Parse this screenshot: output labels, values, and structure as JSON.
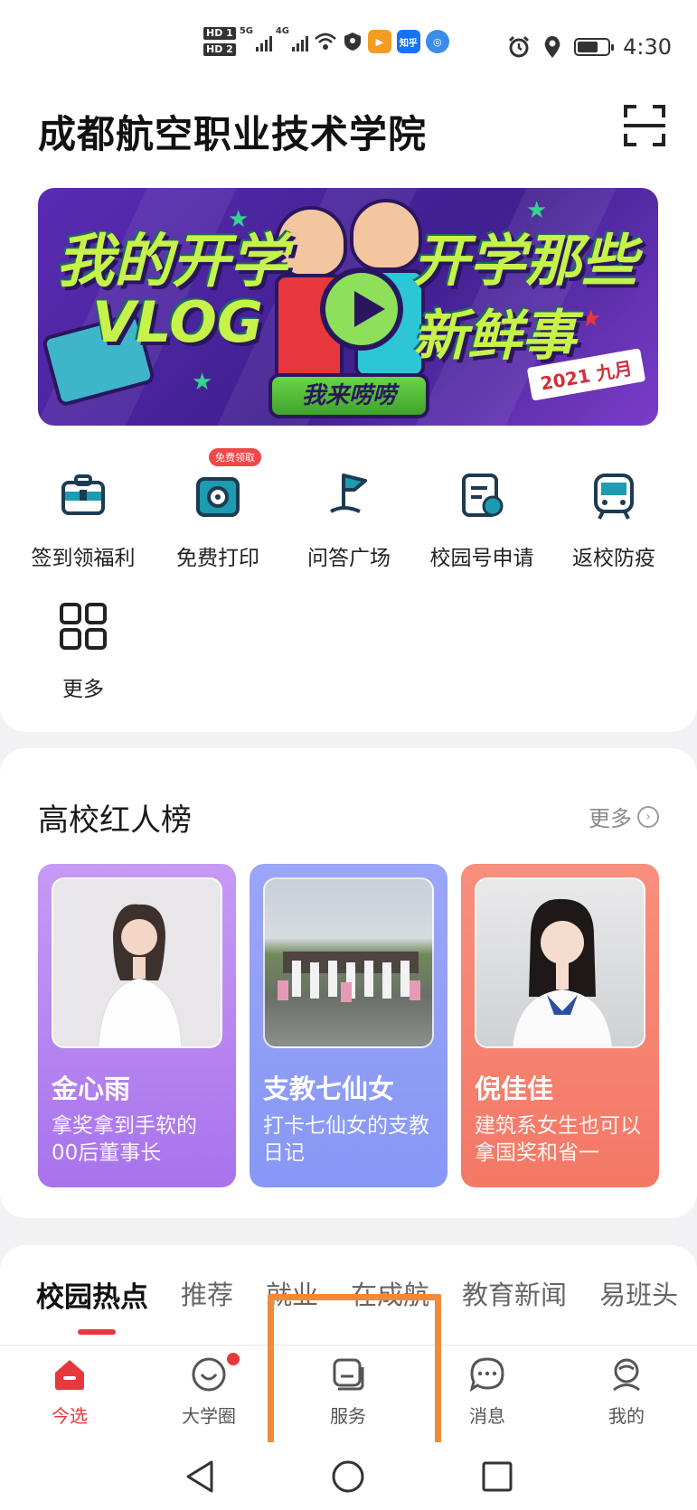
{
  "status_bar": {
    "hd1": "HD 1",
    "hd2": "HD 2",
    "net1": "5G",
    "net2": "4G",
    "app_zhihu": "知乎",
    "time": "4:30"
  },
  "header": {
    "title": "成都航空职业技术学院",
    "scan_icon": "scan-icon"
  },
  "banner": {
    "line1": "我的开学",
    "line2": "VLOG",
    "line3": "开学那些",
    "line4": "新鲜事",
    "button": "我来唠唠",
    "date": "2021 九月"
  },
  "quick_actions": [
    {
      "label": "签到领福利",
      "icon": "briefcase-icon"
    },
    {
      "label": "免费打印",
      "icon": "printer-icon",
      "badge": "免费领取"
    },
    {
      "label": "问答广场",
      "icon": "flag-icon"
    },
    {
      "label": "校园号申请",
      "icon": "application-icon"
    },
    {
      "label": "返校防疫",
      "icon": "train-icon"
    },
    {
      "label": "更多",
      "icon": "grid-icon"
    }
  ],
  "influencers": {
    "title": "高校红人榜",
    "more": "更多",
    "cards": [
      {
        "name": "金心雨",
        "desc": "拿奖拿到手软的00后董事长",
        "color": "#b27ef0"
      },
      {
        "name": "支教七仙女",
        "desc": "打卡七仙女的支教日记",
        "color": "#8d9ef7"
      },
      {
        "name": "倪佳佳",
        "desc": "建筑系女生也可以拿国奖和省一",
        "color": "#f6806d"
      }
    ]
  },
  "news_tabs": [
    "校园热点",
    "推荐",
    "就业",
    "在成航",
    "教育新闻",
    "易班头"
  ],
  "bottom_nav": [
    {
      "label": "今选",
      "icon": "home-icon",
      "active": true
    },
    {
      "label": "大学圈",
      "icon": "smile-icon"
    },
    {
      "label": "服务",
      "icon": "service-icon"
    },
    {
      "label": "消息",
      "icon": "message-icon"
    },
    {
      "label": "我的",
      "icon": "profile-icon"
    }
  ],
  "colors": {
    "accent": "#e8383d",
    "icon_teal": "#1d9bb0",
    "highlight": "#f08a3c"
  }
}
